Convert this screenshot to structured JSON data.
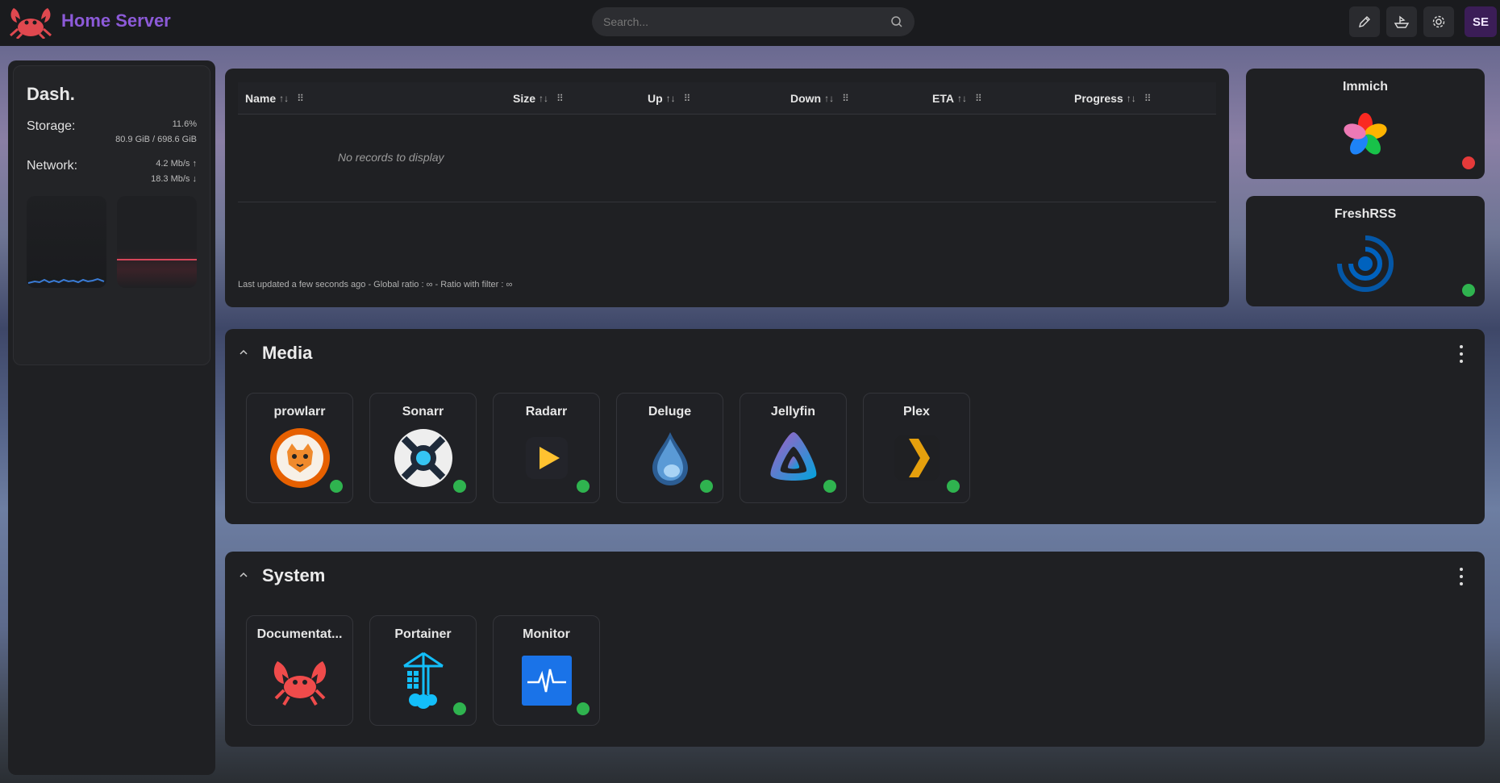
{
  "header": {
    "title": "Home Server",
    "search_placeholder": "Search...",
    "avatar_initials": "SE",
    "accent_color": "#8c5ad8",
    "buttons": [
      "edit-icon",
      "ship-icon",
      "gear-icon"
    ]
  },
  "dash": {
    "title": "Dash.",
    "storage_label": "Storage:",
    "storage_percent": "11.6%",
    "storage_usage": "80.9 GiB / 698.6 GiB",
    "network_label": "Network:",
    "network_up": "4.2 Mb/s",
    "network_down": "18.3 Mb/s"
  },
  "torrents": {
    "columns": [
      "Name",
      "Size",
      "Up",
      "Down",
      "ETA",
      "Progress"
    ],
    "empty_text": "No records to display",
    "footer": "Last updated a few seconds ago - Global ratio : ∞ - Ratio with filter : ∞"
  },
  "widgets": [
    {
      "name": "Immich",
      "status": "red",
      "icon": "immich-icon"
    },
    {
      "name": "FreshRSS",
      "status": "green",
      "icon": "freshrss-icon"
    }
  ],
  "sections": [
    {
      "title": "Media",
      "apps": [
        {
          "name": "prowlarr",
          "status": "green",
          "icon": "prowlarr-icon"
        },
        {
          "name": "Sonarr",
          "status": "green",
          "icon": "sonarr-icon"
        },
        {
          "name": "Radarr",
          "status": "green",
          "icon": "radarr-icon"
        },
        {
          "name": "Deluge",
          "status": "green",
          "icon": "deluge-icon"
        },
        {
          "name": "Jellyfin",
          "status": "green",
          "icon": "jellyfin-icon"
        },
        {
          "name": "Plex",
          "status": "green",
          "icon": "plex-icon"
        }
      ]
    },
    {
      "title": "System",
      "apps": [
        {
          "name": "Documentat...",
          "status": "none",
          "icon": "documentation-icon"
        },
        {
          "name": "Portainer",
          "status": "green",
          "icon": "portainer-icon"
        },
        {
          "name": "Monitor",
          "status": "green",
          "icon": "monitor-icon"
        }
      ]
    }
  ]
}
